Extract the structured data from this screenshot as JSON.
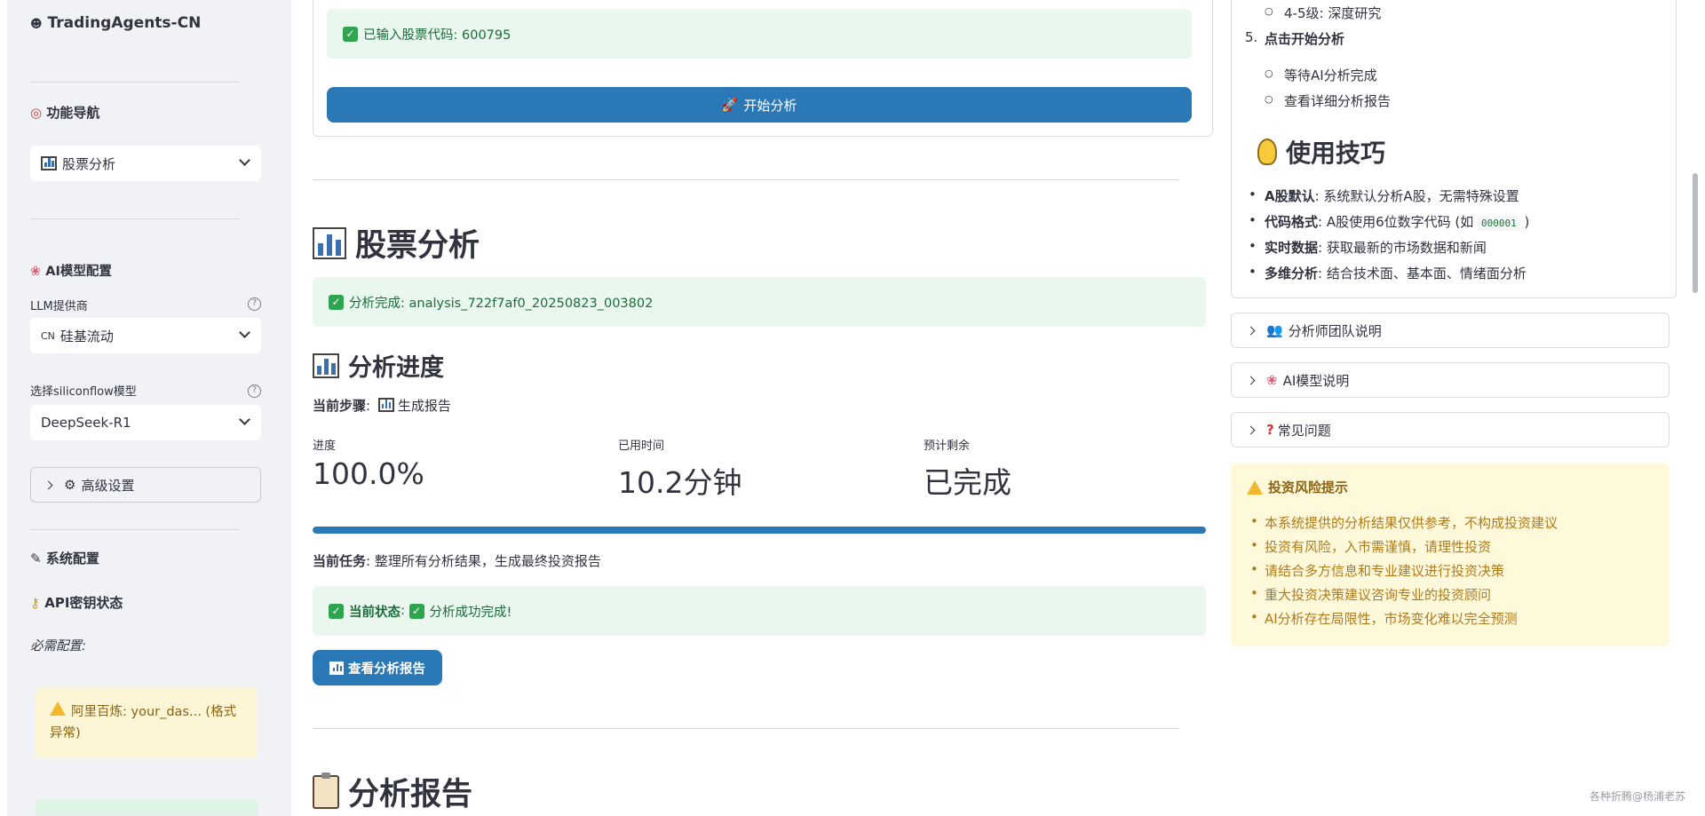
{
  "sidebar": {
    "app_title": "TradingAgents-CN",
    "nav_section": "功能导航",
    "nav_selected": "股票分析",
    "ai_section": "AI模型配置",
    "llm_label": "LLM提供商",
    "llm_prefix": "CN",
    "llm_value": "硅基流动",
    "model_label": "选择siliconflow模型",
    "model_value": "DeepSeek-R1",
    "advanced": "高级设置",
    "system_section": "系统配置",
    "api_section": "API密钥状态",
    "required_label": "必需配置:",
    "warn_text": "阿里百炼: your_das... (格式异常)"
  },
  "main": {
    "ticker_msg": "已输入股票代码: 600795",
    "start_button": "开始分析",
    "stock_title": "股票分析",
    "done_msg": "分析完成: analysis_722f7af0_20250823_003802",
    "progress_title": "分析进度",
    "current_step_label": "当前步骤",
    "current_step_value": "生成报告",
    "metrics": {
      "progress_label": "进度",
      "progress_value": "100.0%",
      "elapsed_label": "已用时间",
      "elapsed_value": "10.2分钟",
      "remaining_label": "预计剩余",
      "remaining_value": "已完成"
    },
    "progress_fraction": 1.0,
    "current_task_label": "当前任务",
    "current_task_value": "整理所有分析结果，生成最终投资报告",
    "status_label": "当前状态",
    "status_value": "分析成功完成!",
    "view_report_button": "查看分析报告",
    "report_title": "分析报告"
  },
  "right": {
    "step4_sub": "4-5级: 深度研究",
    "step5_num": "5.",
    "step5_title": "点击开始分析",
    "step5_subs": [
      "等待AI分析完成",
      "查看详细分析报告"
    ],
    "tips_title": "使用技巧",
    "tips": [
      {
        "bold": "A股默认",
        "text": ": 系统默认分析A股，无需特殊设置"
      },
      {
        "bold": "代码格式",
        "text": ": A股使用6位数字代码 (如 ",
        "code": "000001",
        "tail": " )"
      },
      {
        "bold": "实时数据",
        "text": ": 获取最新的市场数据和新闻"
      },
      {
        "bold": "多维分析",
        "text": ": 结合技术面、基本面、情绪面分析"
      }
    ],
    "expanders": [
      "分析师团队说明",
      "AI模型说明",
      "常见问题"
    ],
    "risk_title": "投资风险提示",
    "risk_items": [
      "本系统提供的分析结果仅供参考，不构成投资建议",
      "投资有风险，入市需谨慎，请理性投资",
      "请结合多方信息和专业建议进行投资决策",
      "重大投资决策建议咨询专业的投资顾问",
      "AI分析存在局限性，市场变化难以完全预测"
    ],
    "watermark": "各种折腾@杨浦老苏"
  },
  "colors": {
    "primary": "#2b78b6",
    "success_bg": "#e9f7ef",
    "warning_bg": "#fff9dc",
    "sidebar_bg": "#f0f2f6"
  }
}
